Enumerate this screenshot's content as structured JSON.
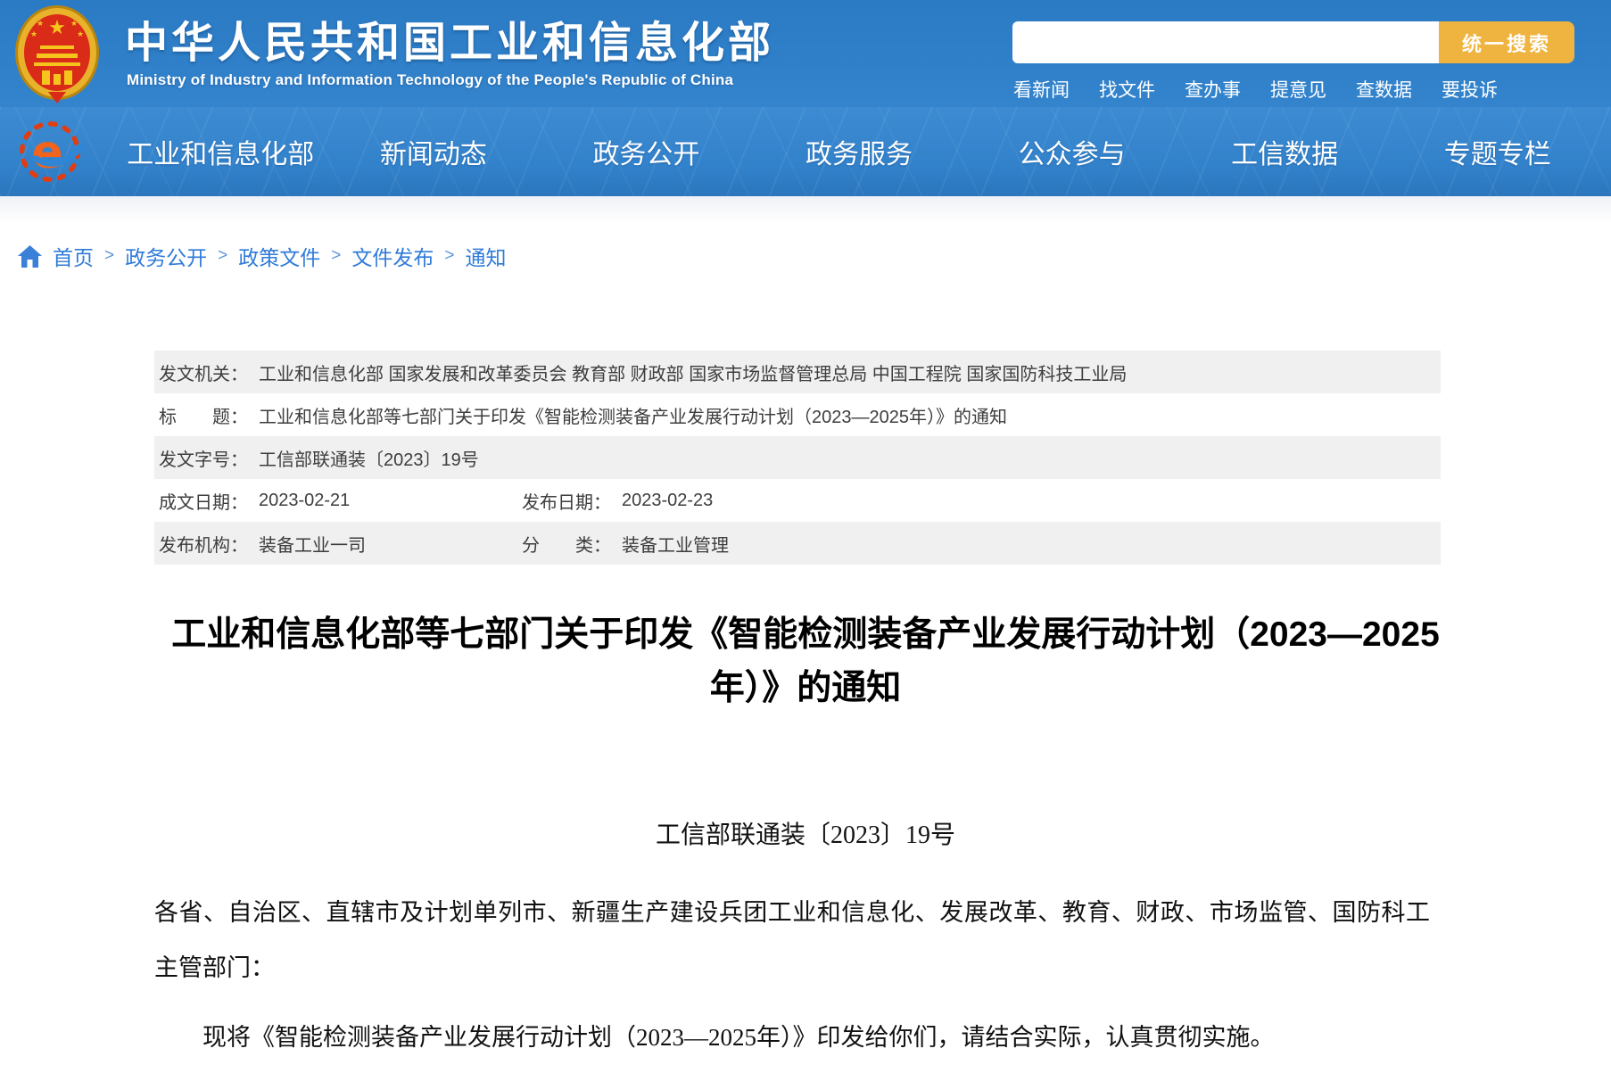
{
  "header": {
    "site_title": "中华人民共和国工业和信息化部",
    "site_subtitle": "Ministry of Industry and Information Technology of the People's Republic of China",
    "search": {
      "value": "",
      "button_label": "统一搜索"
    },
    "quick_links": [
      "看新闻",
      "找文件",
      "查办事",
      "提意见",
      "查数据",
      "要投诉"
    ]
  },
  "navbar": {
    "items": [
      "工业和信息化部",
      "新闻动态",
      "政务公开",
      "政务服务",
      "公众参与",
      "工信数据",
      "专题专栏"
    ]
  },
  "breadcrumb": {
    "separator": ">",
    "items": [
      "首页",
      "政务公开",
      "政策文件",
      "文件发布",
      "通知"
    ]
  },
  "meta_table": {
    "rows": [
      {
        "label": "发文机关：",
        "value": "工业和信息化部 国家发展和改革委员会 教育部 财政部 国家市场监督管理总局 中国工程院 国家国防科技工业局"
      },
      {
        "label": "标　　题：",
        "value": "工业和信息化部等七部门关于印发《智能检测装备产业发展行动计划（2023—2025年）》的通知"
      },
      {
        "label": "发文字号：",
        "value": "工信部联通装〔2023〕19号"
      },
      {
        "label": "成文日期：",
        "value": "2023-02-21",
        "label2": "发布日期：",
        "value2": "2023-02-23"
      },
      {
        "label": "发布机构：",
        "value": "装备工业一司",
        "label2": "分　　类：",
        "value2": "装备工业管理"
      }
    ]
  },
  "article": {
    "title": "工业和信息化部等七部门关于印发《智能检测装备产业发展行动计划（2023—2025年）》的通知",
    "doc_number": "工信部联通装〔2023〕19号",
    "paragraphs": [
      "各省、自治区、直辖市及计划单列市、新疆生产建设兵团工业和信息化、发展改革、教育、财政、市场监管、国防科工主管部门：",
      "现将《智能检测装备产业发展行动计划（2023—2025年）》印发给你们，请结合实际，认真贯彻实施。"
    ]
  },
  "colors": {
    "header_blue": "#2b7ac4",
    "navbar_blue": "#3787d0",
    "accent_orange": "#efb440",
    "link_blue": "#2f7bd9",
    "row_gray": "#f0f0f1"
  }
}
